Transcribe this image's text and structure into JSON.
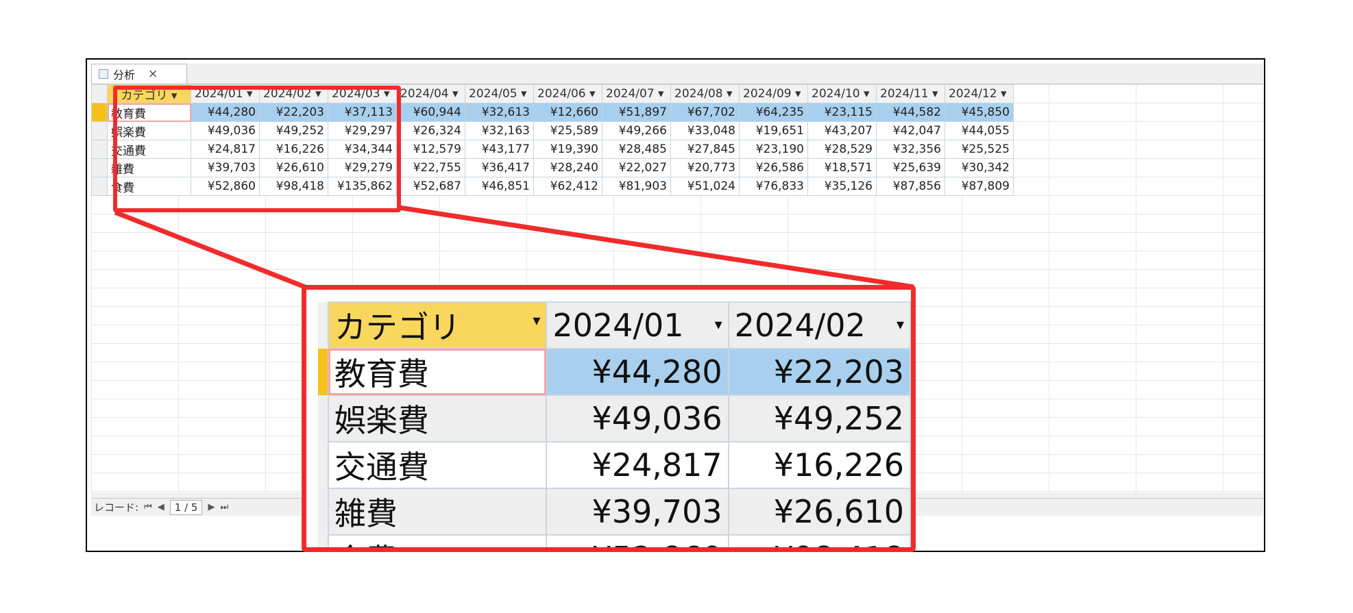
{
  "tab": {
    "title": "分析",
    "close": "×"
  },
  "columns": [
    "カテゴリ",
    "2024/01",
    "2024/02",
    "2024/03",
    "2024/04",
    "2024/05",
    "2024/06",
    "2024/07",
    "2024/08",
    "2024/09",
    "2024/10",
    "2024/11",
    "2024/12"
  ],
  "rows": [
    {
      "category": "教育費",
      "values": [
        "¥44,280",
        "¥22,203",
        "¥37,113",
        "¥60,944",
        "¥32,613",
        "¥12,660",
        "¥51,897",
        "¥67,702",
        "¥64,235",
        "¥23,115",
        "¥44,582",
        "¥45,850"
      ]
    },
    {
      "category": "娯楽費",
      "values": [
        "¥49,036",
        "¥49,252",
        "¥29,297",
        "¥26,324",
        "¥32,163",
        "¥25,589",
        "¥49,266",
        "¥33,048",
        "¥19,651",
        "¥43,207",
        "¥42,047",
        "¥44,055"
      ]
    },
    {
      "category": "交通費",
      "values": [
        "¥24,817",
        "¥16,226",
        "¥34,344",
        "¥12,579",
        "¥43,177",
        "¥19,390",
        "¥28,485",
        "¥27,845",
        "¥23,190",
        "¥28,529",
        "¥32,356",
        "¥25,525"
      ]
    },
    {
      "category": "雑費",
      "values": [
        "¥39,703",
        "¥26,610",
        "¥29,279",
        "¥22,755",
        "¥36,417",
        "¥28,240",
        "¥22,027",
        "¥20,773",
        "¥26,586",
        "¥18,571",
        "¥25,639",
        "¥30,342"
      ]
    },
    {
      "category": "食費",
      "values": [
        "¥52,860",
        "¥98,418",
        "¥135,862",
        "¥52,687",
        "¥46,851",
        "¥62,412",
        "¥81,903",
        "¥51,024",
        "¥76,833",
        "¥35,126",
        "¥87,856",
        "¥87,809"
      ]
    }
  ],
  "record_nav": {
    "label": "レコード:",
    "first": "⏮",
    "prev": "◀",
    "position": "1 / 5",
    "next": "▶",
    "last": "⏭"
  },
  "dropdown_arrow": "▾",
  "colors": {
    "header_category": "#f9d65c",
    "selected_row": "#a8d0ee",
    "highlight": "#f02b2b"
  }
}
